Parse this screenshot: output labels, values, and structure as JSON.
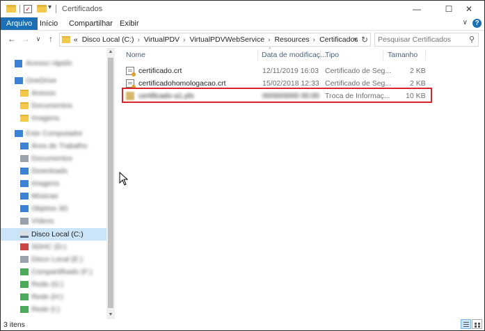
{
  "window": {
    "title": "Certificados",
    "controls": {
      "minimize": "—",
      "maximize": "☐",
      "close": "✕"
    }
  },
  "ribbon": {
    "tabs": [
      "Arquivo",
      "Início",
      "Compartilhar",
      "Exibir"
    ],
    "expand": "∨",
    "help": "?"
  },
  "nav": {
    "back": "←",
    "forward": "→",
    "recent": "∨",
    "up": "↑",
    "overflow": "«",
    "breadcrumb": [
      "Disco Local (C:)",
      "VirtualPDV",
      "VirtualPDVWebService",
      "Resources",
      "Certificados"
    ],
    "crumb_sep": "›",
    "dropdown": "∨",
    "refresh": "↻",
    "search_placeholder": "Pesquisar Certificados",
    "search_icon": "search-icon"
  },
  "sidebar": {
    "items": [
      {
        "label": "Acesso rápido",
        "icon": "star-icon",
        "blurred": true
      },
      {
        "label": "OneDrive",
        "icon": "cloud-icon",
        "blurred": true
      },
      {
        "label": "Anexos",
        "icon": "folder-icon",
        "blurred": true
      },
      {
        "label": "Documentos",
        "icon": "folder-icon",
        "blurred": true
      },
      {
        "label": "Imagens",
        "icon": "folder-icon",
        "blurred": true
      },
      {
        "label": "Este Computador",
        "icon": "computer-icon",
        "blurred": true
      },
      {
        "label": "Área de Trabalho",
        "icon": "desktop-icon",
        "blurred": true
      },
      {
        "label": "Documentos",
        "icon": "documents-icon",
        "blurred": true
      },
      {
        "label": "Downloads",
        "icon": "downloads-icon",
        "blurred": true
      },
      {
        "label": "Imagens",
        "icon": "pictures-icon",
        "blurred": true
      },
      {
        "label": "Músicas",
        "icon": "music-icon",
        "blurred": true
      },
      {
        "label": "Objetos 3D",
        "icon": "objects-icon",
        "blurred": true
      },
      {
        "label": "Vídeos",
        "icon": "videos-icon",
        "blurred": true
      },
      {
        "label": "Disco Local (C:)",
        "icon": "drive-icon",
        "blurred": false,
        "selected": true
      },
      {
        "label": "SDHC (D:)",
        "icon": "sd-card-icon",
        "blurred": true
      },
      {
        "label": "Disco Local (E:)",
        "icon": "drive-icon",
        "blurred": true
      },
      {
        "label": "Compartilhado (F:)",
        "icon": "network-drive-icon",
        "blurred": true
      },
      {
        "label": "Rede (G:)",
        "icon": "network-drive-icon",
        "blurred": true
      },
      {
        "label": "Rede (H:)",
        "icon": "network-drive-icon",
        "blurred": true
      },
      {
        "label": "Rede (I:)",
        "icon": "network-drive-icon",
        "blurred": true
      }
    ]
  },
  "list": {
    "columns": [
      "Nome",
      "Data de modificaç...",
      "Tipo",
      "Tamanho"
    ],
    "sort_indicator": "^",
    "rows": [
      {
        "name": "certificado.crt",
        "date": "12/11/2019 16:03",
        "type": "Certificado de Seg...",
        "size": "2 KB",
        "icon": "certificate-icon",
        "blurred": false,
        "highlighted": false
      },
      {
        "name": "certificadohomologacao.crt",
        "date": "15/02/2018 12:33",
        "type": "Certificado de Seg...",
        "size": "2 KB",
        "icon": "certificate-icon",
        "blurred": false,
        "highlighted": false
      },
      {
        "name": "certificado-a1.pfx",
        "date": "00/00/0000 00:00",
        "type": "Troca de Informaç...",
        "size": "10 KB",
        "icon": "pfx-icon",
        "blurred": true,
        "highlighted": true
      }
    ]
  },
  "status": {
    "items_count": "3 itens"
  },
  "colors": {
    "accent": "#1d6fb5",
    "selection": "#cce4f7",
    "highlight_border": "#d9232a",
    "header_text": "#4c607a"
  }
}
